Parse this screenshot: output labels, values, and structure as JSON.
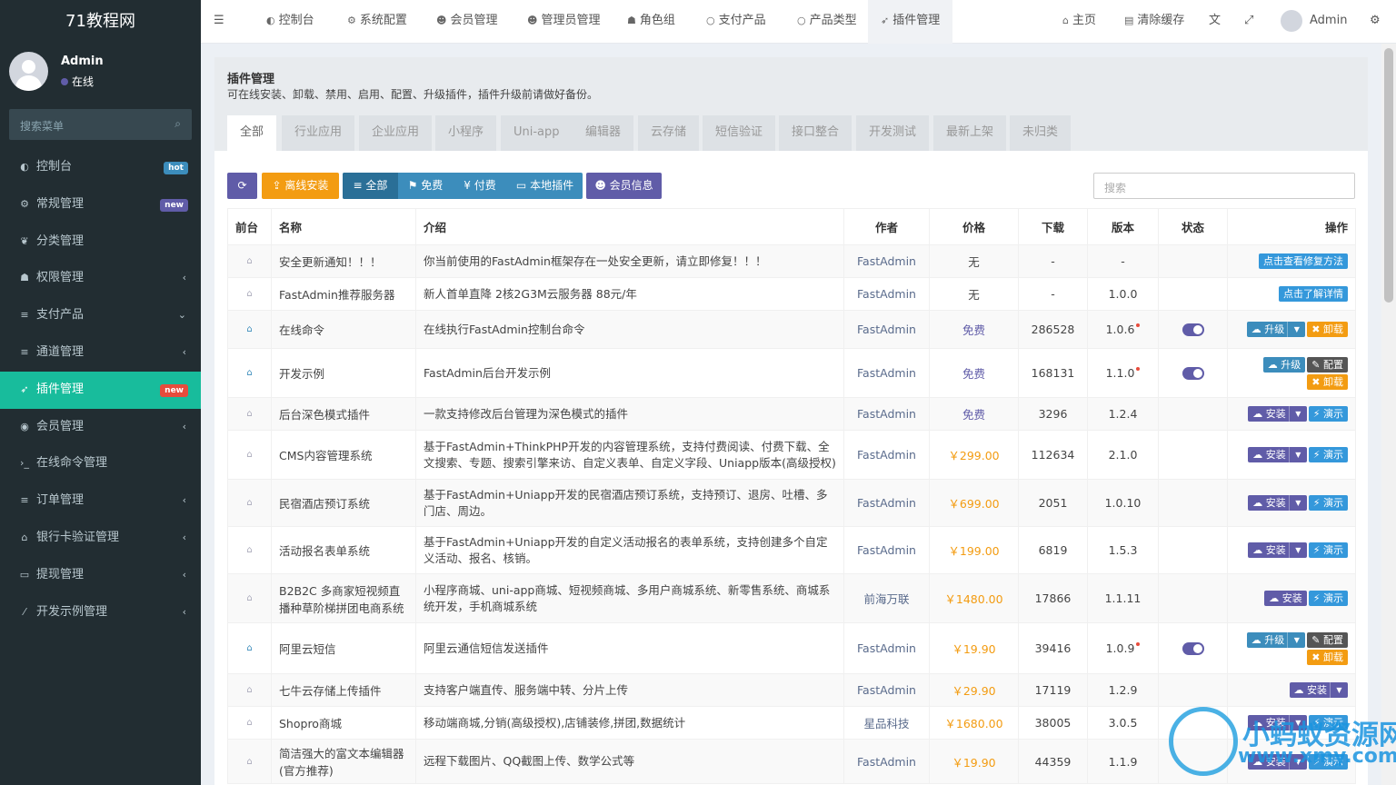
{
  "app": {
    "logo": "71教程网"
  },
  "user": {
    "name": "Admin",
    "status": "在线"
  },
  "sidebar": {
    "search_placeholder": "搜索菜单",
    "items": [
      {
        "label": "控制台",
        "icon": "dashboard-icon",
        "glyph": "◐",
        "badge": "hot",
        "badge_color": "#3c8dbc"
      },
      {
        "label": "常规管理",
        "icon": "cogs-icon",
        "glyph": "⚙",
        "badge": "new",
        "badge_color": "#605ca8"
      },
      {
        "label": "分类管理",
        "icon": "leaf-icon",
        "glyph": "❦"
      },
      {
        "label": "权限管理",
        "icon": "group-icon",
        "glyph": "☗",
        "arrow": "‹"
      },
      {
        "label": "支付产品",
        "icon": "list-icon",
        "glyph": "≡",
        "arrow": "⌄"
      },
      {
        "label": "通道管理",
        "icon": "list-icon",
        "glyph": "≡",
        "arrow": "‹"
      },
      {
        "label": "插件管理",
        "icon": "rocket-icon",
        "glyph": "➶",
        "badge": "new",
        "badge_color": "#e74c3c",
        "active": true
      },
      {
        "label": "会员管理",
        "icon": "user-circle-icon",
        "glyph": "◉",
        "arrow": "‹"
      },
      {
        "label": "在线命令管理",
        "icon": "terminal-icon",
        "glyph": "›_"
      },
      {
        "label": "订单管理",
        "icon": "list-icon",
        "glyph": "≡",
        "arrow": "‹"
      },
      {
        "label": "银行卡验证管理",
        "icon": "bank-icon",
        "glyph": "⌂",
        "arrow": "‹"
      },
      {
        "label": "提现管理",
        "icon": "visa-icon",
        "glyph": "▭",
        "arrow": "‹"
      },
      {
        "label": "开发示例管理",
        "icon": "magic-icon",
        "glyph": "⁄",
        "arrow": "‹"
      }
    ]
  },
  "topnav": {
    "items": [
      {
        "label": "控制台",
        "icon": "dashboard-icon",
        "glyph": "◐"
      },
      {
        "label": "系统配置",
        "icon": "cog-icon",
        "glyph": "⚙"
      },
      {
        "label": "会员管理",
        "icon": "user-icon",
        "glyph": "☻"
      },
      {
        "label": "管理员管理",
        "icon": "user-icon",
        "glyph": "☻"
      },
      {
        "label": "角色组",
        "icon": "group-icon",
        "glyph": "☗"
      },
      {
        "label": "支付产品",
        "icon": "circle-icon",
        "glyph": "○"
      },
      {
        "label": "产品类型",
        "icon": "circle-icon",
        "glyph": "○"
      },
      {
        "label": "插件管理",
        "icon": "rocket-icon",
        "glyph": "➶",
        "active": true
      }
    ],
    "home": "主页",
    "clear_cache": "清除缓存",
    "admin": "Admin"
  },
  "page": {
    "title": "插件管理",
    "desc": "可在线安装、卸载、禁用、启用、配置、升级插件，插件升级前请做好备份。",
    "tabs": [
      "全部",
      "行业应用",
      "企业应用",
      "小程序",
      "Uni-app",
      "编辑器",
      "云存储",
      "短信验证",
      "接口整合",
      "开发测试",
      "最新上架",
      "未归类"
    ]
  },
  "toolbar": {
    "offline": "离线安装",
    "all": "全部",
    "free": "免费",
    "paid": "付费",
    "local": "本地插件",
    "member": "会员信息",
    "search_placeholder": "搜索"
  },
  "table": {
    "headers": [
      "前台",
      "名称",
      "介绍",
      "作者",
      "价格",
      "下载",
      "版本",
      "状态",
      "操作"
    ],
    "rows": [
      {
        "home": false,
        "name": "安全更新通知！！！",
        "intro": "你当前使用的FastAdmin框架存在一处安全更新，请立即修复！！！",
        "author": "FastAdmin",
        "price": "无",
        "ptype": "none",
        "downloads": "-",
        "version": "-",
        "new": false,
        "status": false,
        "ops": [
          [
            "点击查看修复方法",
            "cy"
          ]
        ]
      },
      {
        "home": false,
        "name": "FastAdmin推荐服务器",
        "intro": "新人首单直降 2核2G3M云服务器 88元/年",
        "author": "FastAdmin",
        "price": "无",
        "ptype": "none",
        "downloads": "-",
        "version": "1.0.0",
        "new": false,
        "status": false,
        "ops": [
          [
            "点击了解详情",
            "cy"
          ]
        ]
      },
      {
        "home": true,
        "name": "在线命令",
        "intro": "在线执行FastAdmin控制台命令",
        "author": "FastAdmin",
        "price": "免费",
        "ptype": "free",
        "downloads": "286528",
        "version": "1.0.6",
        "new": true,
        "status": true,
        "ops": [
          [
            "☁ 升级",
            "bl",
            "c"
          ],
          [
            "✖ 卸载",
            "or"
          ]
        ]
      },
      {
        "home": true,
        "name": "开发示例",
        "intro": "FastAdmin后台开发示例",
        "author": "FastAdmin",
        "price": "免费",
        "ptype": "free",
        "downloads": "168131",
        "version": "1.1.0",
        "new": true,
        "status": true,
        "ops": [
          [
            "☁ 升级",
            "bl"
          ],
          [
            "✎ 配置",
            "gr"
          ],
          [
            "br"
          ],
          [
            "✖ 卸载",
            "or"
          ]
        ]
      },
      {
        "home": false,
        "name": "后台深色模式插件",
        "intro": "一款支持修改后台管理为深色模式的插件",
        "author": "FastAdmin",
        "price": "免费",
        "ptype": "free",
        "downloads": "3296",
        "version": "1.2.4",
        "new": false,
        "status": false,
        "ops": [
          [
            "☁ 安装",
            "pu",
            "c"
          ],
          [
            "⚡ 演示",
            "cy"
          ]
        ]
      },
      {
        "home": false,
        "name": "CMS内容管理系统",
        "intro": "基于FastAdmin+ThinkPHP开发的内容管理系统，支持付费阅读、付费下载、全文搜索、专题、搜索引擎来访、自定义表单、自定义字段、Uniapp版本(高级授权)",
        "author": "FastAdmin",
        "price": "￥299.00",
        "ptype": "paid",
        "downloads": "112634",
        "version": "2.1.0",
        "new": false,
        "status": false,
        "ops": [
          [
            "☁ 安装",
            "pu",
            "c"
          ],
          [
            "⚡ 演示",
            "cy"
          ]
        ]
      },
      {
        "home": false,
        "name": "民宿酒店预订系统",
        "intro": "基于FastAdmin+Uniapp开发的民宿酒店预订系统，支持预订、退房、吐槽、多门店、周边。",
        "author": "FastAdmin",
        "price": "￥699.00",
        "ptype": "paid",
        "downloads": "2051",
        "version": "1.0.10",
        "new": false,
        "status": false,
        "ops": [
          [
            "☁ 安装",
            "pu",
            "c"
          ],
          [
            "⚡ 演示",
            "cy"
          ]
        ]
      },
      {
        "home": false,
        "name": "活动报名表单系统",
        "intro": "基于FastAdmin+Uniapp开发的自定义活动报名的表单系统，支持创建多个自定义活动、报名、核销。",
        "author": "FastAdmin",
        "price": "￥199.00",
        "ptype": "paid",
        "downloads": "6819",
        "version": "1.5.3",
        "new": false,
        "status": false,
        "ops": [
          [
            "☁ 安装",
            "pu",
            "c"
          ],
          [
            "⚡ 演示",
            "cy"
          ]
        ]
      },
      {
        "home": false,
        "name": "B2B2C 多商家短视频直播种草阶梯拼团电商系统",
        "intro": "小程序商城、uni-app商城、短视频商城、多用户商城系统、新零售系统、商城系统开发，手机商城系统",
        "author": "前海万联",
        "price": "￥1480.00",
        "ptype": "paid",
        "downloads": "17866",
        "version": "1.1.11",
        "new": false,
        "status": false,
        "ops": [
          [
            "☁ 安装",
            "pu"
          ],
          [
            "⚡ 演示",
            "cy"
          ]
        ]
      },
      {
        "home": true,
        "name": "阿里云短信",
        "intro": "阿里云通信短信发送插件",
        "author": "FastAdmin",
        "price": "￥19.90",
        "ptype": "paid",
        "downloads": "39416",
        "version": "1.0.9",
        "new": true,
        "status": true,
        "ops": [
          [
            "☁ 升级",
            "bl",
            "c"
          ],
          [
            "✎ 配置",
            "gr"
          ],
          [
            "br"
          ],
          [
            "✖ 卸载",
            "or"
          ]
        ]
      },
      {
        "home": false,
        "name": "七牛云存储上传插件",
        "intro": "支持客户端直传、服务端中转、分片上传",
        "author": "FastAdmin",
        "price": "￥29.90",
        "ptype": "paid",
        "downloads": "17119",
        "version": "1.2.9",
        "new": false,
        "status": false,
        "ops": [
          [
            "☁ 安装",
            "pu",
            "c"
          ]
        ]
      },
      {
        "home": false,
        "name": "Shopro商城",
        "intro": "移动端商城,分销(高级授权),店铺装修,拼团,数据统计",
        "author": "星品科技",
        "price": "￥1680.00",
        "ptype": "paid",
        "downloads": "38005",
        "version": "3.0.5",
        "new": false,
        "status": false,
        "ops": [
          [
            "☁ 安装",
            "pu",
            "c"
          ],
          [
            "⚡ 演示",
            "cy"
          ]
        ]
      },
      {
        "home": false,
        "name": "简洁强大的富文本编辑器(官方推荐)",
        "intro": "远程下载图片、QQ截图上传、数学公式等",
        "author": "FastAdmin",
        "price": "￥19.90",
        "ptype": "paid",
        "downloads": "44359",
        "version": "1.1.9",
        "new": false,
        "status": false,
        "ops": [
          [
            "☁ 安装",
            "pu",
            "c"
          ],
          [
            "⚡ 演示",
            "cy"
          ]
        ]
      }
    ]
  },
  "watermark": {
    "line1": "小蚂蚁资源网",
    "line2": "www.xmy.com"
  }
}
